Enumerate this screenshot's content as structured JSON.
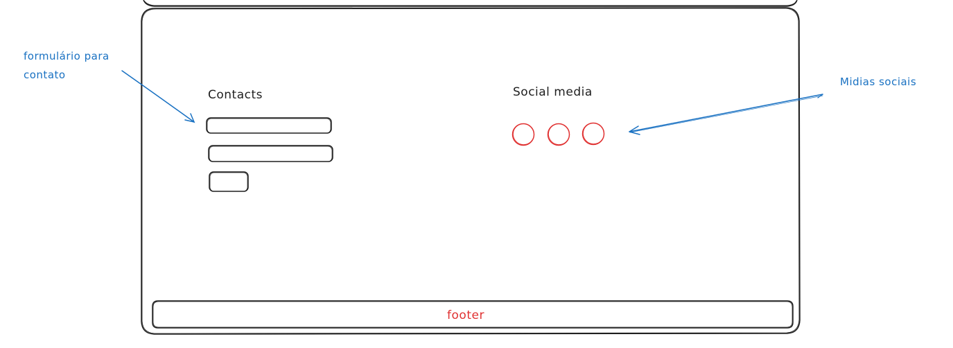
{
  "annotations": {
    "form_note_line1": "formulário para",
    "form_note_line2": "contato",
    "social_note": "Midias sociais"
  },
  "page": {
    "contacts_heading": "Contacts",
    "social_heading": "Social media",
    "footer_label": "footer",
    "social_icon_count": 3
  },
  "colors": {
    "ink": "#1e1e1e",
    "annotation": "#1971c2",
    "accent": "#e03131"
  }
}
